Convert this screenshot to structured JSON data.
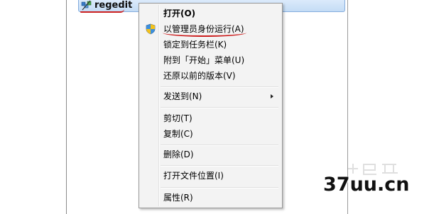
{
  "search_result": {
    "label": "regedit",
    "icon": "registry-editor-icon"
  },
  "context_menu": {
    "items": [
      {
        "label": "打开(O)",
        "bold": true
      },
      {
        "label": "以管理员身份运行(A)",
        "icon": "uac-shield-icon"
      },
      {
        "label": "锁定到任务栏(K)"
      },
      {
        "label": "附到「开始」菜单(U)"
      },
      {
        "label": "还原以前的版本(V)"
      },
      {
        "label": "发送到(N)",
        "submenu": true
      },
      {
        "label": "剪切(T)"
      },
      {
        "label": "复制(C)"
      },
      {
        "label": "删除(D)"
      },
      {
        "label": "打开文件位置(I)"
      },
      {
        "label": "属性(R)"
      }
    ]
  },
  "watermark": {
    "text": "37uu.cn"
  },
  "colors": {
    "highlight_red": "#cc1f1f",
    "menu_bg": "#f3f3f3",
    "selection_blue": "#c4dcf5"
  }
}
